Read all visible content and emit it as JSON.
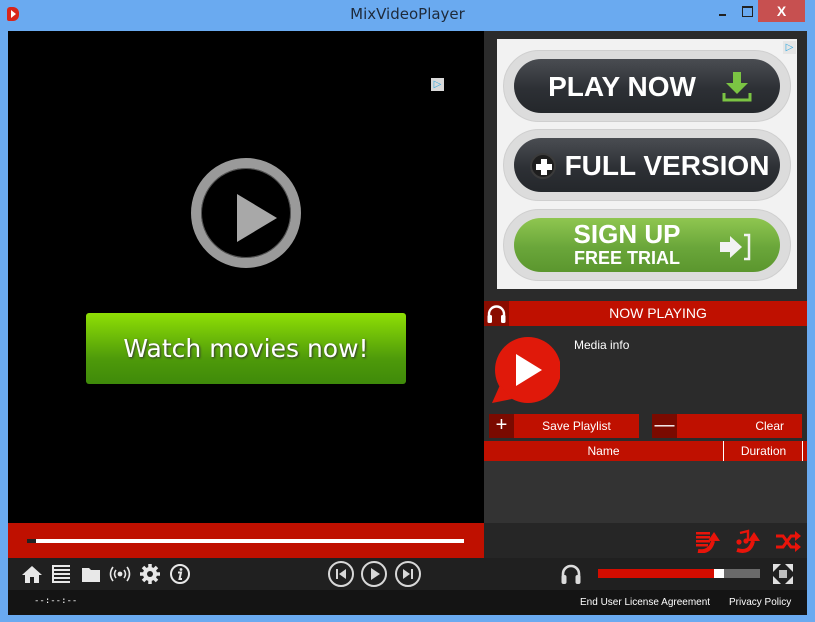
{
  "window": {
    "title": "MixVideoPlayer",
    "close_glyph": "X"
  },
  "video": {
    "ad_choice_glyph": "▷",
    "cta": "Watch movies now!",
    "seek_progress_percent": 2
  },
  "ad": {
    "ad_choice_glyph": "▷",
    "buttons": [
      {
        "label": "PLAY NOW",
        "icon": "download-icon"
      },
      {
        "label": "FULL VERSION",
        "icon": "plus-icon"
      },
      {
        "line1": "SIGN UP",
        "line2": "FREE TRIAL",
        "icon": "sign-in-icon"
      }
    ]
  },
  "now_playing": {
    "title": "NOW PLAYING",
    "media_info": "Media info"
  },
  "playlist": {
    "save_symbol": "+",
    "save_label": "Save Playlist",
    "clear_symbol": "—",
    "clear_label": "Clear",
    "columns": [
      "Name",
      "Duration"
    ],
    "rows": []
  },
  "controls": {
    "left_icons": [
      "home-icon",
      "playlist-icon",
      "folder-icon",
      "stream-icon",
      "settings-icon",
      "info-icon"
    ],
    "transport": [
      "previous-icon",
      "play-icon",
      "next-icon"
    ],
    "volume_percent": 78,
    "mode_icons": [
      "repeat-playlist-icon",
      "repeat-track-icon",
      "shuffle-icon"
    ]
  },
  "status": {
    "time": "--:--:--",
    "eula": "End User License Agreement",
    "privacy": "Privacy Policy"
  },
  "colors": {
    "accent_red": "#bf1000",
    "frame_blue": "#6aaaf0",
    "cta_green": "#5fae0a"
  }
}
